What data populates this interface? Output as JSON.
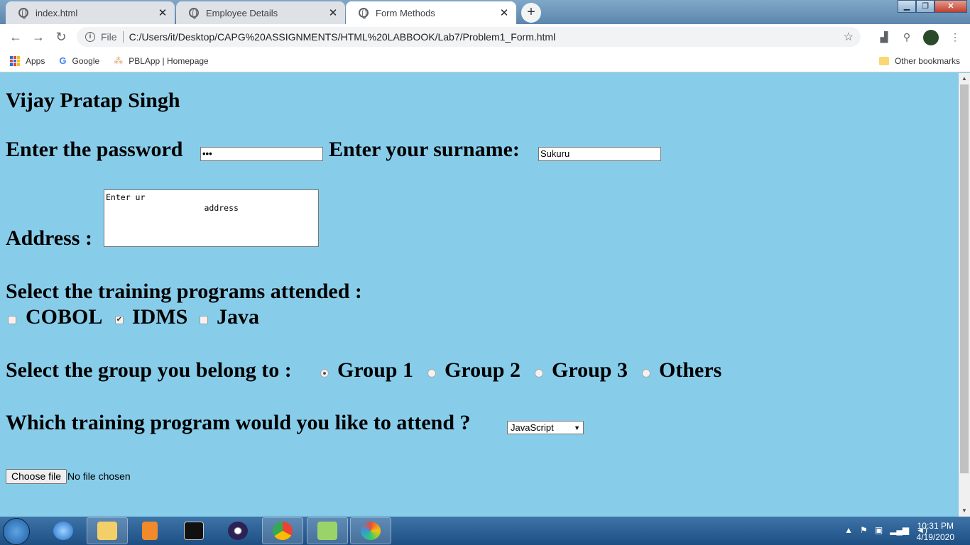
{
  "browser": {
    "tabs": [
      {
        "title": "index.html",
        "active": false
      },
      {
        "title": "Employee Details",
        "active": false
      },
      {
        "title": "Form Methods",
        "active": true
      }
    ],
    "scheme_label": "File",
    "url": "C:/Users/it/Desktop/CAPG%20ASSIGNMENTS/HTML%20LABBOOK/Lab7/Problem1_Form.html",
    "bookmarks": [
      {
        "label": "Apps",
        "icon": "apps-grid-icon"
      },
      {
        "label": "Google",
        "icon": "google-icon"
      },
      {
        "label": "PBLApp | Homepage",
        "icon": "pblapp-icon"
      }
    ],
    "other_bookmarks": "Other bookmarks"
  },
  "page": {
    "heading": "Vijay Pratap Singh",
    "password_label": "Enter the password",
    "password_value": "•••",
    "surname_label": "Enter your surname:",
    "surname_value": "Sukuru",
    "address_label": "Address :",
    "address_value": "Enter ur\n                    address",
    "training_label": "Select the training programs attended :",
    "trainings": [
      {
        "label": "COBOL",
        "checked": false
      },
      {
        "label": "IDMS",
        "checked": true
      },
      {
        "label": "Java",
        "checked": false
      }
    ],
    "group_label": "Select the group you belong to :",
    "groups": [
      {
        "label": "Group 1",
        "selected": true
      },
      {
        "label": "Group 2",
        "selected": false
      },
      {
        "label": "Group 3",
        "selected": false
      },
      {
        "label": "Others",
        "selected": false
      }
    ],
    "program_label": "Which training program would you like to attend ?",
    "program_selected": "JavaScript",
    "file_button": "Choose file",
    "file_status": "No file chosen"
  },
  "taskbar": {
    "time": "10:31 PM",
    "date": "4/19/2020",
    "apps": [
      "internet-explorer-icon",
      "file-explorer-icon",
      "media-player-icon",
      "cmd-icon",
      "eclipse-icon",
      "chrome-icon",
      "notepad-plus-icon",
      "paint-icon"
    ]
  },
  "colors": {
    "page_bg": "#87cdea",
    "chrome_tab_active": "#ffffff",
    "taskbar": "#1d4f83"
  }
}
